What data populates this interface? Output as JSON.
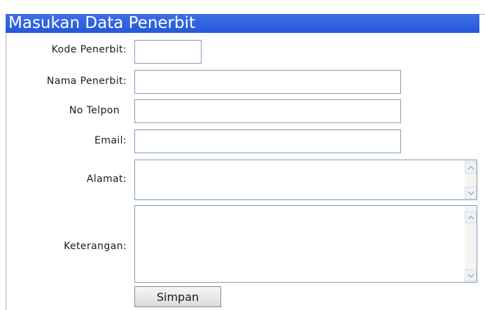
{
  "form": {
    "title": "Masukan Data Penerbit",
    "fields": {
      "kode": {
        "label": "Kode Penerbit:",
        "value": ""
      },
      "nama": {
        "label": "Nama Penerbit:",
        "value": ""
      },
      "telpon": {
        "label": "No Telpon",
        "value": ""
      },
      "email": {
        "label": "Email:",
        "value": ""
      },
      "alamat": {
        "label": "Alamat:",
        "value": ""
      },
      "keterangan": {
        "label": "Keterangan:",
        "value": ""
      }
    },
    "submit_label": "Simpan"
  }
}
